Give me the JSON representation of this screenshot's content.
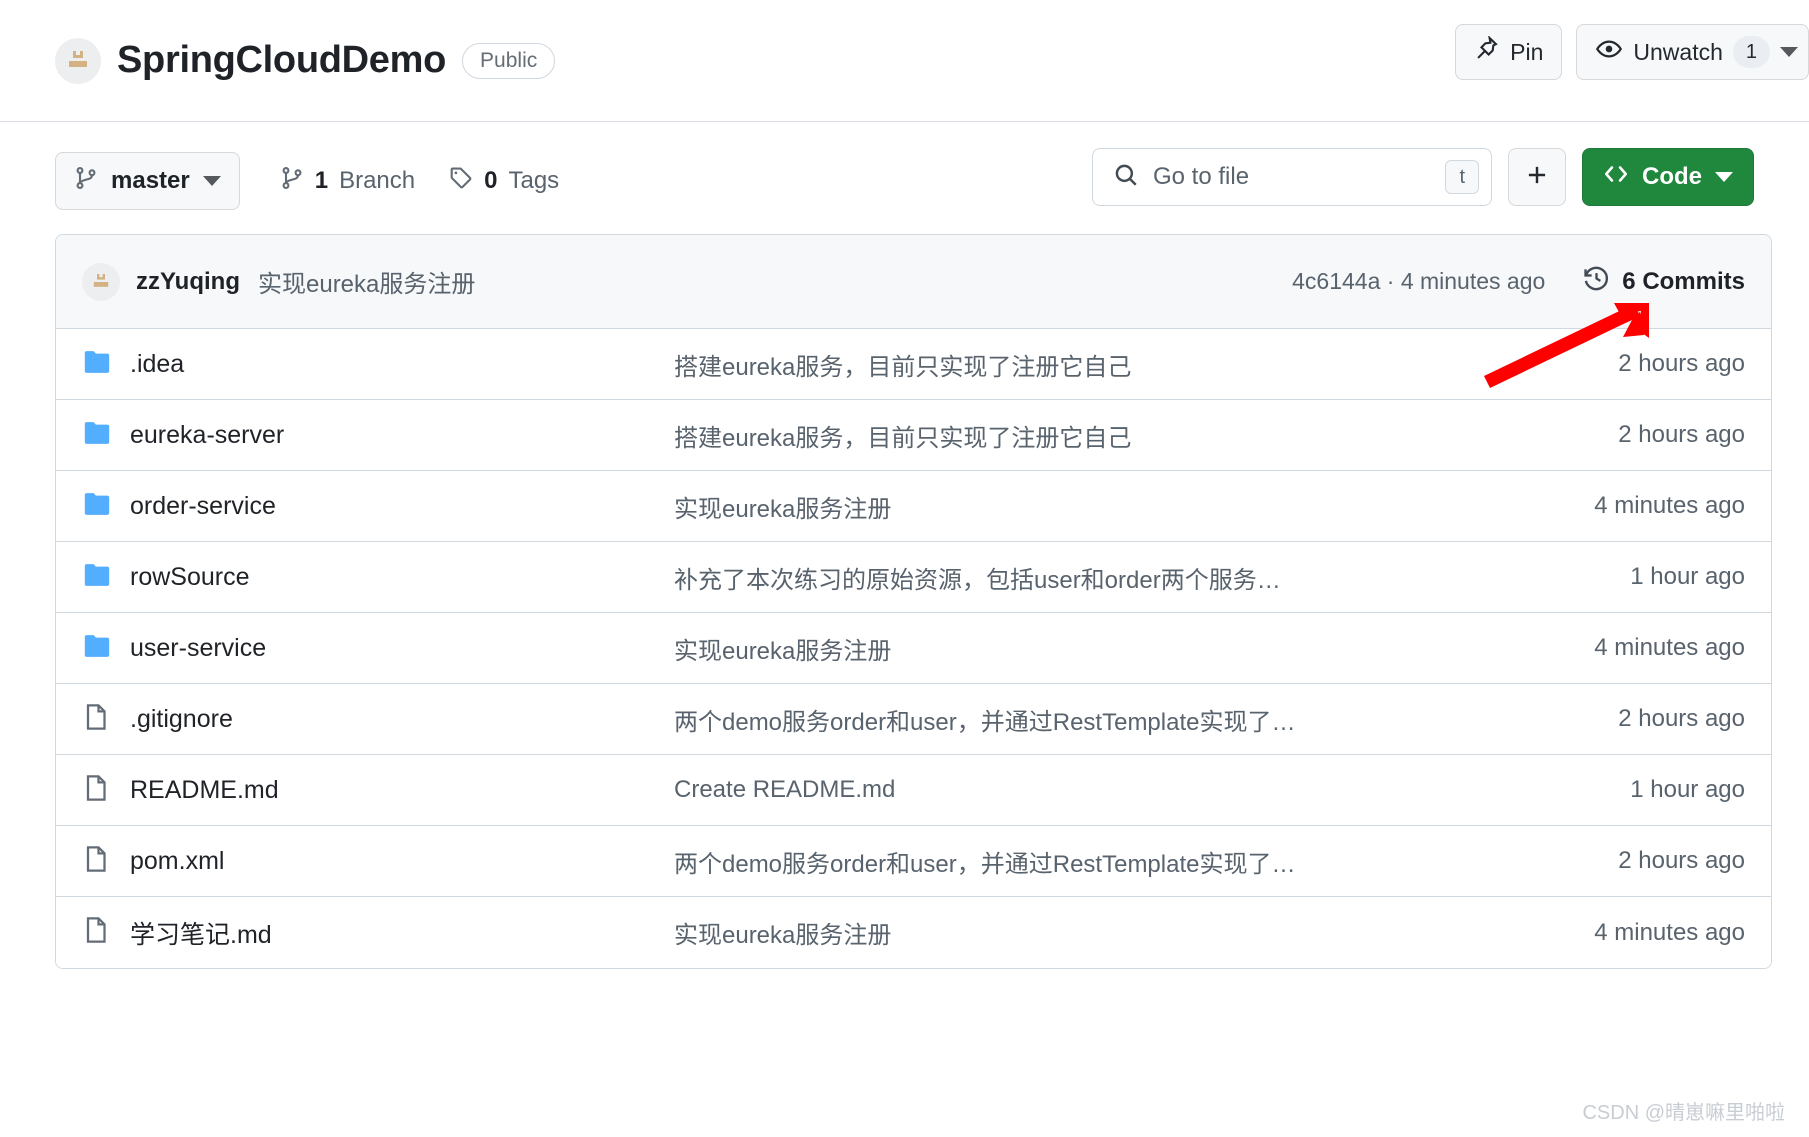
{
  "header": {
    "avatar_icon": "repo-owner-avatar-icon",
    "repo_name": "SpringCloudDemo",
    "visibility": "Public",
    "pin_label": "Pin",
    "pin_icon": "pin-icon",
    "unwatch_label": "Unwatch",
    "unwatch_icon": "eye-icon",
    "watch_count": "1",
    "unwatch_caret_icon": "chevron-down-icon"
  },
  "toolbar": {
    "branch_name": "master",
    "branch_icon": "branch-icon",
    "branch_caret_icon": "chevron-down-icon",
    "branches_count": "1",
    "branches_label": "Branch",
    "branches_icon": "branch-icon",
    "tags_count": "0",
    "tags_label": "Tags",
    "tags_icon": "tag-icon",
    "search_placeholder": "Go to file",
    "search_icon": "search-icon",
    "search_shortcut": "t",
    "add_icon": "plus-icon",
    "code_label": "Code",
    "code_icon": "code-brackets-icon",
    "code_caret_icon": "chevron-down-icon",
    "code_button_color": "#1f883d"
  },
  "commit_bar": {
    "avatar_icon": "commit-author-avatar-icon",
    "author": "zzYuqing",
    "message": "实现eureka服务注册",
    "sha_and_time": "4c6144a · 4 minutes ago",
    "history_icon": "history-clock-icon",
    "commits_label": "6 Commits"
  },
  "files": [
    {
      "icon": "folder-icon",
      "type": "folder",
      "name": ".idea",
      "message": "搭建eureka服务，目前只实现了注册它自己",
      "time": "2 hours ago"
    },
    {
      "icon": "folder-icon",
      "type": "folder",
      "name": "eureka-server",
      "message": "搭建eureka服务，目前只实现了注册它自己",
      "time": "2 hours ago"
    },
    {
      "icon": "folder-icon",
      "type": "folder",
      "name": "order-service",
      "message": "实现eureka服务注册",
      "time": "4 minutes ago"
    },
    {
      "icon": "folder-icon",
      "type": "folder",
      "name": "rowSource",
      "message": "补充了本次练习的原始资源，包括user和order两个服务…",
      "time": "1 hour ago"
    },
    {
      "icon": "folder-icon",
      "type": "folder",
      "name": "user-service",
      "message": "实现eureka服务注册",
      "time": "4 minutes ago"
    },
    {
      "icon": "file-icon",
      "type": "file",
      "name": ".gitignore",
      "message": "两个demo服务order和user，并通过RestTemplate实现了…",
      "time": "2 hours ago"
    },
    {
      "icon": "file-icon",
      "type": "file",
      "name": "README.md",
      "message": "Create README.md",
      "time": "1 hour ago"
    },
    {
      "icon": "file-icon",
      "type": "file",
      "name": "pom.xml",
      "message": "两个demo服务order和user，并通过RestTemplate实现了…",
      "time": "2 hours ago"
    },
    {
      "icon": "file-icon",
      "type": "file",
      "name": "学习笔记.md",
      "message": "实现eureka服务注册",
      "time": "4 minutes ago"
    }
  ],
  "annotation": {
    "arrow_color": "#fe0000",
    "arrow_target": "6 Commits"
  },
  "watermark": "CSDN @晴崽嘛里啪啦"
}
